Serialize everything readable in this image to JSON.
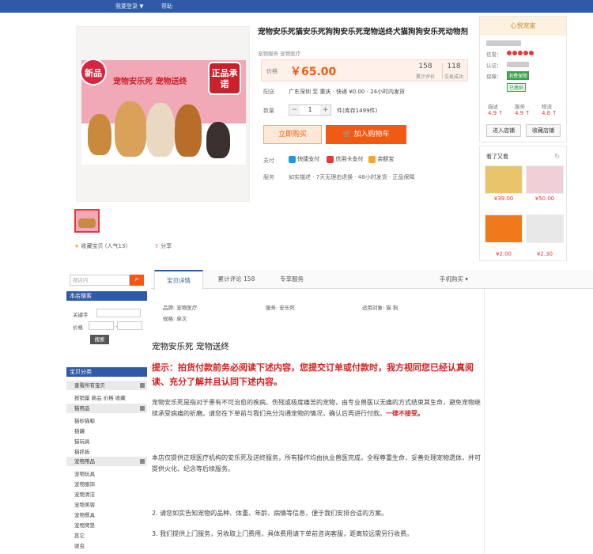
{
  "topbar": {
    "item1": "我要登录 ▼",
    "item2": "帮助"
  },
  "product": {
    "title": "宠物安乐死猫安乐死狗狗安乐死宠物送终犬猫狗狗安乐死动物剂",
    "subtitle": "宠物服务 宠物医疗",
    "image_badge_left": "新品",
    "image_promo": "宠物安乐死 宠物送终",
    "image_badge_right": "正品承诺",
    "price_label": "价格",
    "price": "￥65.00",
    "stat1_num": "158",
    "stat1_label": "累计评价",
    "stat2_num": "118",
    "stat2_label": "交易成功",
    "delivery_label": "配送",
    "delivery_text": "广东深圳 至 重庆 · 快递 ¥0.00 · 24小时内发货",
    "qty_label": "数量",
    "qty_value": "1",
    "qty_stock": "件(库存1499件)",
    "buy_label": "立即购买",
    "cart_label": "加入购物车",
    "pay_label": "支付",
    "pay1": "快捷支付",
    "pay2": "信用卡支付",
    "pay3": "余额宝",
    "promise_label": "服务",
    "promise_text": "如实描述 · 7天无理由退换 · 48小时发货 · 正品保障",
    "thumb_link1": "收藏宝贝 (人气13)",
    "thumb_link2": "分享"
  },
  "store": {
    "header": "心悦宠家",
    "label_rep": "信誉：",
    "label_credit": "认证：",
    "label_guar": "保障：",
    "badge1": "消费保障",
    "badge2": "已缴纳",
    "score1_t": "描述",
    "score1_v": "4.9 ↑",
    "score2_t": "服务",
    "score2_v": "4.9 ↑",
    "score3_t": "物流",
    "score3_v": "4.8 ↑",
    "btn_enter": "进入店铺",
    "btn_fav": "收藏店铺",
    "recent_title": "看了又看",
    "rec1_price": "¥39.00",
    "rec2_price": "¥50.00",
    "rec3_price": "¥2.00",
    "rec4_price": "¥2.30"
  },
  "sidebar": {
    "search_placeholder": "搜店内",
    "hdr_store_search": "本店搜索",
    "kw_label": "关键字",
    "price_label": "价格",
    "price_from": "",
    "price_to": "",
    "search_btn": "搜索",
    "hdr_category": "宝贝分类",
    "cat1": "查看所有宝贝",
    "cat2": "按销量 新品 价格 收藏",
    "grp1": "猫用品",
    "cat3": "猫砂猫粮",
    "cat4": "猫罐",
    "cat5": "猫玩具",
    "cat6": "猫抓板",
    "grp2": "宠物用品",
    "cat7": "宠物玩具",
    "cat8": "宠物服饰",
    "cat9": "宠物清洁",
    "cat10": "宠物美容",
    "cat11": "宠物餐具",
    "cat12": "宠物窝垫",
    "cat13": "其它",
    "cat14": "驱虫",
    "cat15": "宠物医疗"
  },
  "tabs": {
    "tab1": "宝贝详情",
    "tab2": "累计评论 158",
    "tab3": "专享服务",
    "tab4": "手机购买 ▾"
  },
  "attributes": {
    "a1": "品牌: 宠物医疗",
    "a2": "服务: 安乐死",
    "a3": "适用对象: 猫 狗",
    "a4": "规格: 单次",
    "a5": "适用体型: 全部"
  },
  "description": {
    "heading": "宠物安乐死  宠物送终",
    "tip": "提示：拍货付款前务必阅读下述内容，您提交订单或付款时，我方视同您已经认真阅读、充分了解并且认同下述内容。",
    "para1": "宠物安乐死是指对于患有不可治愈的疾病、伤残或极度痛苦的宠物，由专业兽医以无痛的方式结束其生命，避免宠物继续承受病痛的折磨。请您在下单前与我们充分沟通宠物的情况，确认后再进行付款。",
    "para1_red": "一律不接受。",
    "para2": "本店仅提供正规医疗机构的安乐死及送终服务，所有操作均由执业兽医完成，全程尊重生命，妥善处理宠物遗体，并可提供火化、纪念等后续服务。",
    "item2": "2. 请您如实告知宠物的品种、体重、年龄、病情等信息，便于我们安排合适的方案。",
    "item3": "3. 我们提供上门服务，另收取上门费用，具体费用请下单前咨询客服，距离较远需另行收费。"
  }
}
